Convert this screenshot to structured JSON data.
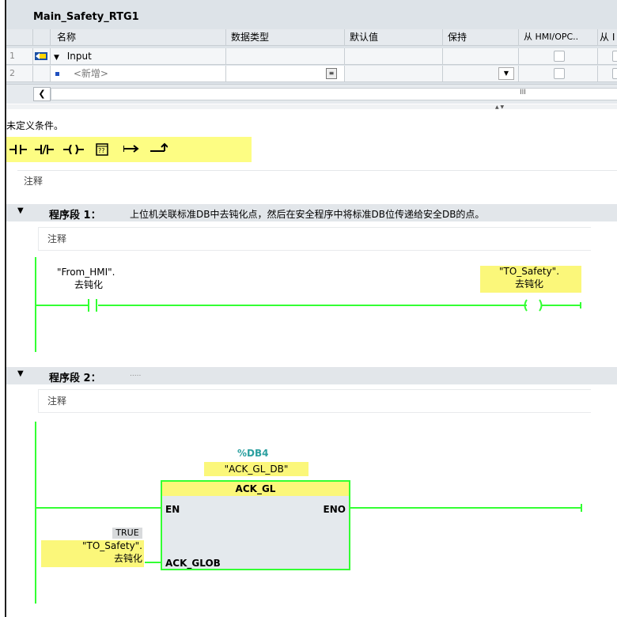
{
  "interface": {
    "title": "Main_Safety_RTG1",
    "columns": [
      "名称",
      "数据类型",
      "默认值",
      "保持",
      "从 HMI/OPC..",
      "从 I"
    ],
    "rows": [
      {
        "num": "1",
        "name": "Input"
      },
      {
        "num": "2",
        "name": "<新增>"
      }
    ],
    "scroll_marker": "III"
  },
  "condition_text": "未定义条件。",
  "toolbar": {
    "items": [
      {
        "icon": "contact-no-icon",
        "glyph": "⊣⊢"
      },
      {
        "icon": "contact-nc-icon",
        "glyph": "⊣/⊢"
      },
      {
        "icon": "coil-icon",
        "glyph": "–( )–"
      },
      {
        "icon": "empty-box-icon",
        "glyph": "??"
      },
      {
        "icon": "open-branch-icon",
        "glyph": "↦"
      },
      {
        "icon": "close-branch-icon",
        "glyph": "⬏"
      }
    ]
  },
  "block_comment": "注释",
  "networks": [
    {
      "title": "程序段 1：",
      "description": "上位机关联标准DB中去钝化点，然后在安全程序中将标准DB位传递给安全DB的点。",
      "comment": "注释",
      "contact": {
        "line1": "\"From_HMI\".",
        "line2": "去钝化"
      },
      "coil": {
        "line1": "\"TO_Safety\".",
        "line2": "去钝化"
      }
    },
    {
      "title": "程序段 2：",
      "description": ".....",
      "comment": "注释",
      "instance": {
        "address": "%DB4",
        "name": "\"ACK_GL_DB\""
      },
      "block": {
        "name": "ACK_GL",
        "en": "EN",
        "eno": "ENO",
        "input": "ACK_GLOB"
      },
      "input_value": "TRUE",
      "input_tag": {
        "line1": "\"TO_Safety\".",
        "line2": "去钝化"
      }
    }
  ],
  "colors": {
    "accent_green": "#33ff33",
    "highlight_yellow": "#fbf77a",
    "instance_teal": "#2ca0a0"
  }
}
